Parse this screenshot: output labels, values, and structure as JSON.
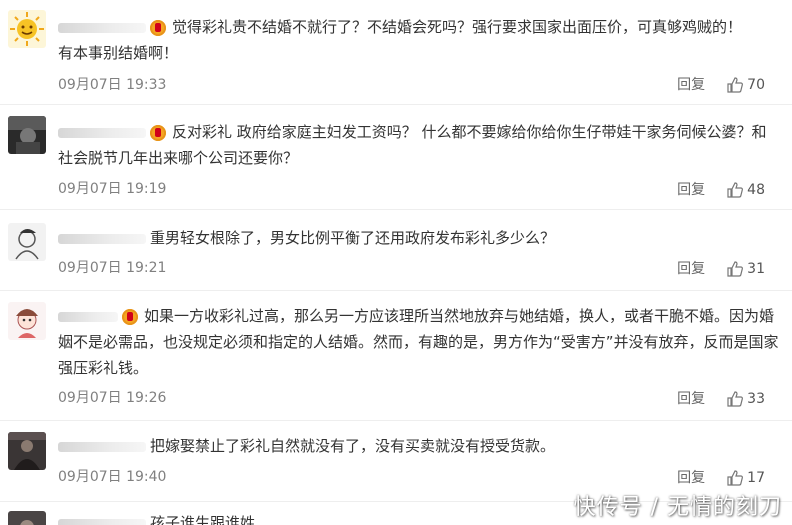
{
  "comments": [
    {
      "lines": [
        "觉得彩礼贵不结婚不就行了？不结婚会死吗？强行要求国家出面压价，可真够鸡贼的！",
        "有本事别结婚啊！"
      ],
      "time": "09月07日 19:33",
      "reply": "回复",
      "likes": "70"
    },
    {
      "lines": [
        "反对彩礼 政府给家庭主妇发工资吗？ 什么都不要嫁给你给你生仔带娃干家务伺候公婆？和",
        "社会脱节几年出来哪个公司还要你？"
      ],
      "time": "09月07日 19:19",
      "reply": "回复",
      "likes": "48"
    },
    {
      "lines": [
        "重男轻女根除了，男女比例平衡了还用政府发布彩礼多少么？"
      ],
      "time": "09月07日 19:21",
      "reply": "回复",
      "likes": "31"
    },
    {
      "lines": [
        "如果一方收彩礼过高，那么另一方应该理所当然地放弃与她结婚，换人，或者干脆不婚。因为婚",
        "姻不是必需品，也没规定必须和指定的人结婚。然而，有趣的是，男方作为“受害方”并没有放弃，反而是国家",
        "强压彩礼钱。"
      ],
      "time": "09月07日 19:26",
      "reply": "回复",
      "likes": "33"
    },
    {
      "lines": [
        "把嫁娶禁止了彩礼自然就没有了，没有买卖就没有授受货款。"
      ],
      "time": "09月07日 19:40",
      "reply": "回复",
      "likes": "17"
    },
    {
      "lines": [
        "孩子谁生跟谁姓"
      ]
    }
  ],
  "watermark": "快传号 / 无情的刻刀",
  "colors": {
    "meta": "#808080",
    "text": "#333333",
    "crown": "#f5a623"
  }
}
